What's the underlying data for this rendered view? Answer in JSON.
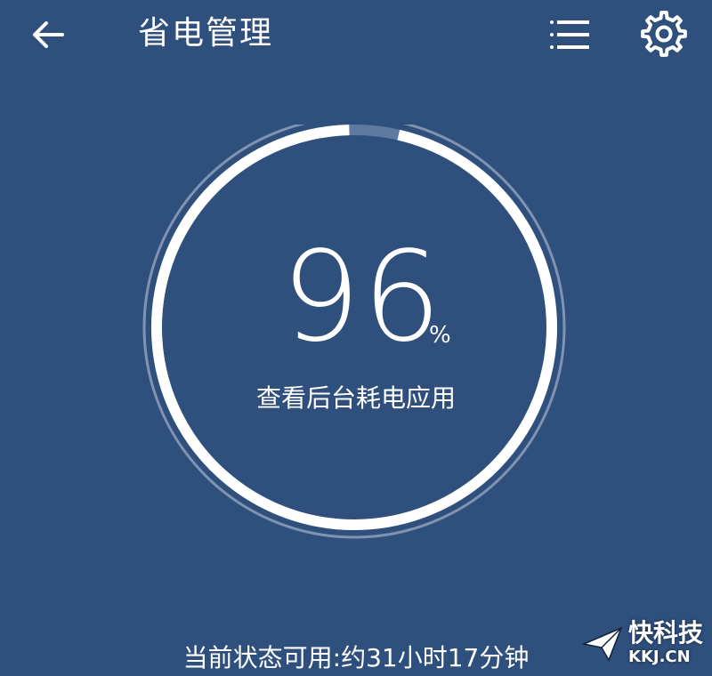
{
  "header": {
    "title": "省电管理",
    "back_icon": "arrow-left-icon",
    "menu_icon": "list-icon",
    "settings_icon": "gear-icon"
  },
  "gauge": {
    "value": "96",
    "unit": "%",
    "fraction": 0.96,
    "label": "查看后台耗电应用"
  },
  "status": {
    "text": "当前状态可用:约31小时17分钟"
  },
  "watermark": {
    "brand": "快科技",
    "url": "KKJ.CN"
  },
  "colors": {
    "background": "#2f4f7c",
    "foreground": "#ffffff",
    "track": "#7f93b2"
  }
}
